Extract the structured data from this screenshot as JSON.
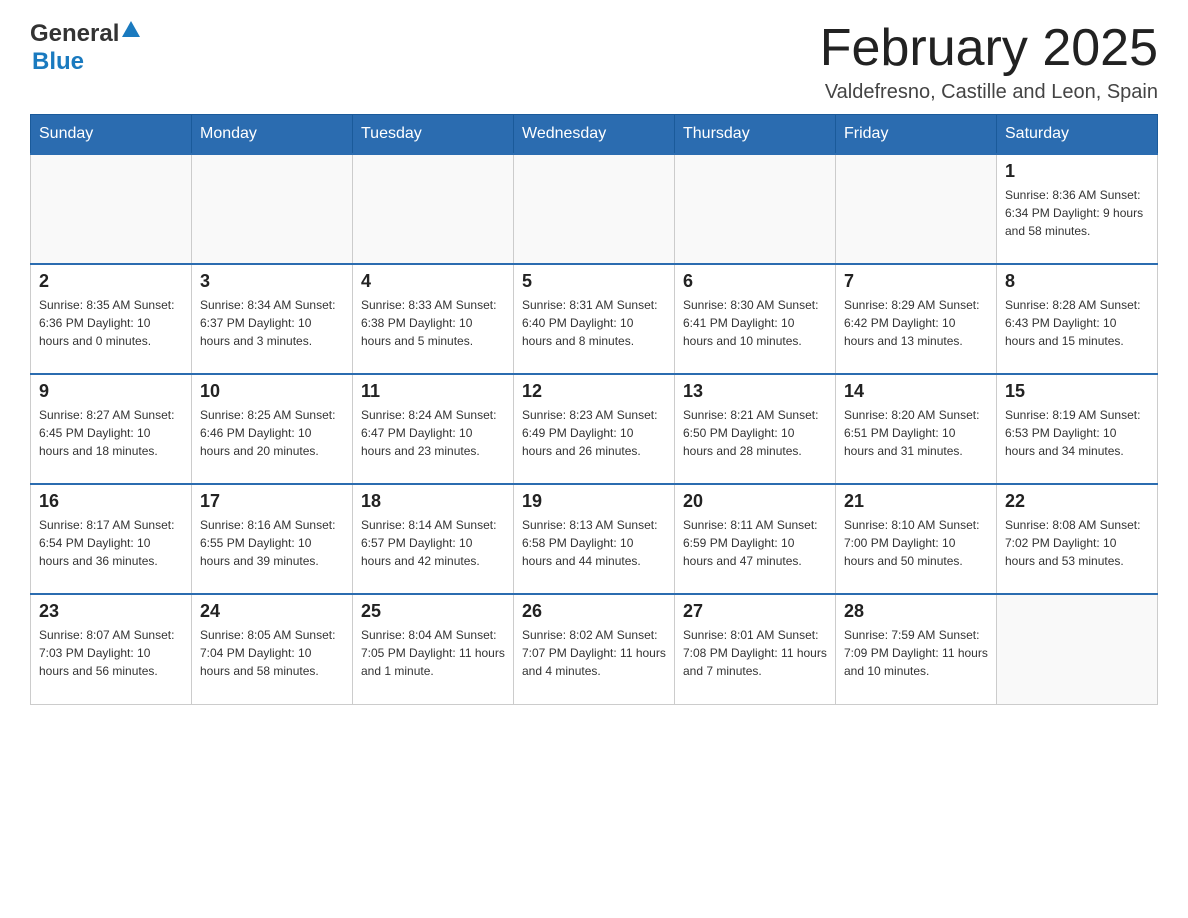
{
  "header": {
    "logo": {
      "text1": "General",
      "text2": "Blue"
    },
    "title": "February 2025",
    "location": "Valdefresno, Castille and Leon, Spain"
  },
  "days_of_week": [
    "Sunday",
    "Monday",
    "Tuesday",
    "Wednesday",
    "Thursday",
    "Friday",
    "Saturday"
  ],
  "weeks": [
    [
      {
        "day": "",
        "info": ""
      },
      {
        "day": "",
        "info": ""
      },
      {
        "day": "",
        "info": ""
      },
      {
        "day": "",
        "info": ""
      },
      {
        "day": "",
        "info": ""
      },
      {
        "day": "",
        "info": ""
      },
      {
        "day": "1",
        "info": "Sunrise: 8:36 AM\nSunset: 6:34 PM\nDaylight: 9 hours and 58 minutes."
      }
    ],
    [
      {
        "day": "2",
        "info": "Sunrise: 8:35 AM\nSunset: 6:36 PM\nDaylight: 10 hours and 0 minutes."
      },
      {
        "day": "3",
        "info": "Sunrise: 8:34 AM\nSunset: 6:37 PM\nDaylight: 10 hours and 3 minutes."
      },
      {
        "day": "4",
        "info": "Sunrise: 8:33 AM\nSunset: 6:38 PM\nDaylight: 10 hours and 5 minutes."
      },
      {
        "day": "5",
        "info": "Sunrise: 8:31 AM\nSunset: 6:40 PM\nDaylight: 10 hours and 8 minutes."
      },
      {
        "day": "6",
        "info": "Sunrise: 8:30 AM\nSunset: 6:41 PM\nDaylight: 10 hours and 10 minutes."
      },
      {
        "day": "7",
        "info": "Sunrise: 8:29 AM\nSunset: 6:42 PM\nDaylight: 10 hours and 13 minutes."
      },
      {
        "day": "8",
        "info": "Sunrise: 8:28 AM\nSunset: 6:43 PM\nDaylight: 10 hours and 15 minutes."
      }
    ],
    [
      {
        "day": "9",
        "info": "Sunrise: 8:27 AM\nSunset: 6:45 PM\nDaylight: 10 hours and 18 minutes."
      },
      {
        "day": "10",
        "info": "Sunrise: 8:25 AM\nSunset: 6:46 PM\nDaylight: 10 hours and 20 minutes."
      },
      {
        "day": "11",
        "info": "Sunrise: 8:24 AM\nSunset: 6:47 PM\nDaylight: 10 hours and 23 minutes."
      },
      {
        "day": "12",
        "info": "Sunrise: 8:23 AM\nSunset: 6:49 PM\nDaylight: 10 hours and 26 minutes."
      },
      {
        "day": "13",
        "info": "Sunrise: 8:21 AM\nSunset: 6:50 PM\nDaylight: 10 hours and 28 minutes."
      },
      {
        "day": "14",
        "info": "Sunrise: 8:20 AM\nSunset: 6:51 PM\nDaylight: 10 hours and 31 minutes."
      },
      {
        "day": "15",
        "info": "Sunrise: 8:19 AM\nSunset: 6:53 PM\nDaylight: 10 hours and 34 minutes."
      }
    ],
    [
      {
        "day": "16",
        "info": "Sunrise: 8:17 AM\nSunset: 6:54 PM\nDaylight: 10 hours and 36 minutes."
      },
      {
        "day": "17",
        "info": "Sunrise: 8:16 AM\nSunset: 6:55 PM\nDaylight: 10 hours and 39 minutes."
      },
      {
        "day": "18",
        "info": "Sunrise: 8:14 AM\nSunset: 6:57 PM\nDaylight: 10 hours and 42 minutes."
      },
      {
        "day": "19",
        "info": "Sunrise: 8:13 AM\nSunset: 6:58 PM\nDaylight: 10 hours and 44 minutes."
      },
      {
        "day": "20",
        "info": "Sunrise: 8:11 AM\nSunset: 6:59 PM\nDaylight: 10 hours and 47 minutes."
      },
      {
        "day": "21",
        "info": "Sunrise: 8:10 AM\nSunset: 7:00 PM\nDaylight: 10 hours and 50 minutes."
      },
      {
        "day": "22",
        "info": "Sunrise: 8:08 AM\nSunset: 7:02 PM\nDaylight: 10 hours and 53 minutes."
      }
    ],
    [
      {
        "day": "23",
        "info": "Sunrise: 8:07 AM\nSunset: 7:03 PM\nDaylight: 10 hours and 56 minutes."
      },
      {
        "day": "24",
        "info": "Sunrise: 8:05 AM\nSunset: 7:04 PM\nDaylight: 10 hours and 58 minutes."
      },
      {
        "day": "25",
        "info": "Sunrise: 8:04 AM\nSunset: 7:05 PM\nDaylight: 11 hours and 1 minute."
      },
      {
        "day": "26",
        "info": "Sunrise: 8:02 AM\nSunset: 7:07 PM\nDaylight: 11 hours and 4 minutes."
      },
      {
        "day": "27",
        "info": "Sunrise: 8:01 AM\nSunset: 7:08 PM\nDaylight: 11 hours and 7 minutes."
      },
      {
        "day": "28",
        "info": "Sunrise: 7:59 AM\nSunset: 7:09 PM\nDaylight: 11 hours and 10 minutes."
      },
      {
        "day": "",
        "info": ""
      }
    ]
  ]
}
